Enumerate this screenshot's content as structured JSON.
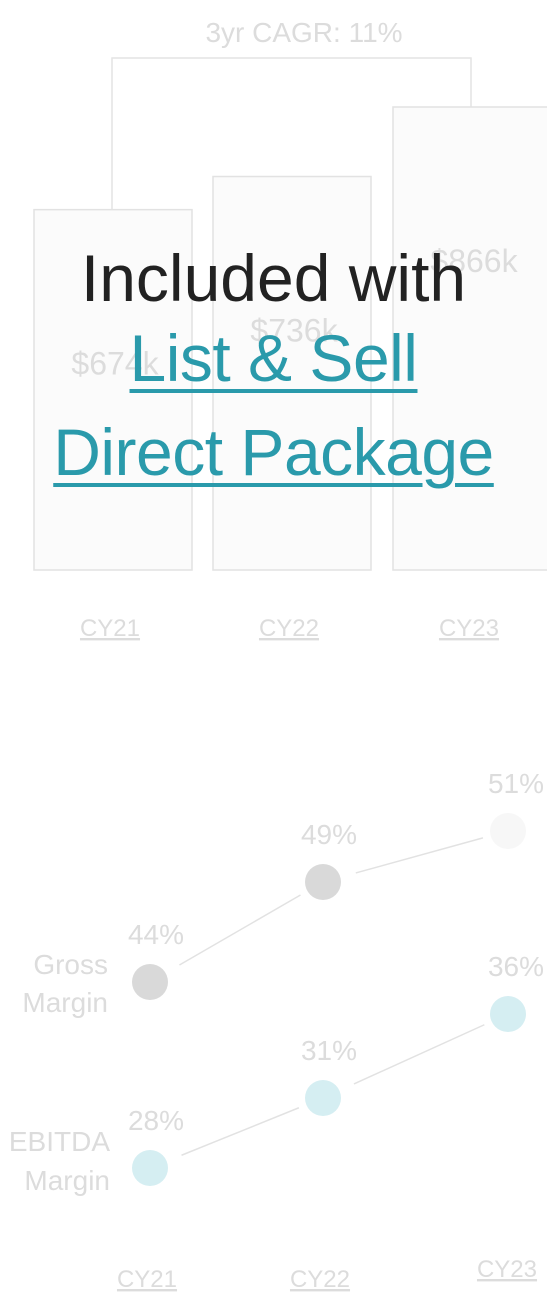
{
  "overlay": {
    "headline": "Included with",
    "link_line1": "List & Sell",
    "link_line2": "Direct Package",
    "link_color": "#2a9aab"
  },
  "chart_data": [
    {
      "type": "bar",
      "categories": [
        "CY21",
        "CY22",
        "CY23"
      ],
      "values": [
        674,
        736,
        866
      ],
      "value_labels": [
        "$674k",
        "$736k",
        "$866k"
      ],
      "annotation": "3yr CAGR: 11%",
      "ylim": [
        0,
        1000
      ]
    },
    {
      "type": "line",
      "x": [
        "CY21",
        "CY22",
        "CY23"
      ],
      "series": [
        {
          "name": "Gross Margin",
          "values": [
            44,
            49,
            51
          ],
          "labels": [
            "44%",
            "49%",
            "51%"
          ],
          "color": "#d9d9d9"
        },
        {
          "name": "EBITDA Margin",
          "values": [
            28,
            31,
            36
          ],
          "labels": [
            "28%",
            "31%",
            "36%"
          ],
          "color": "#d5eef2"
        }
      ],
      "ylim": [
        20,
        55
      ]
    }
  ]
}
